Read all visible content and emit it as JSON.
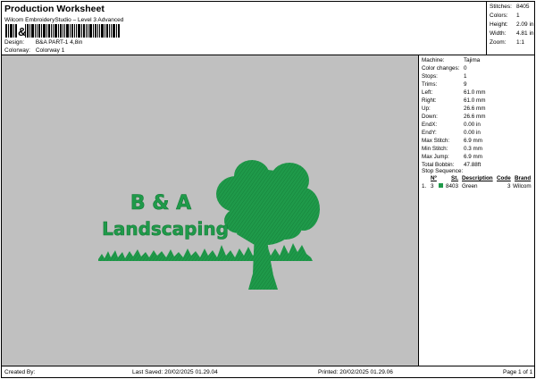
{
  "header": {
    "title": "Production Worksheet",
    "subtitle": "Wilcom EmbroideryStudio – Level 3 Advanced",
    "design_label": "Design:",
    "design_value": "B&A PART-1 4,8in",
    "colorway_label": "Colorway:",
    "colorway_value": "Colorway 1"
  },
  "stats": [
    {
      "label": "Stitches:",
      "value": "8405"
    },
    {
      "label": "Colors:",
      "value": "1"
    },
    {
      "label": "Height:",
      "value": "2.09 in"
    },
    {
      "label": "Width:",
      "value": "4.81 in"
    },
    {
      "label": "Zoom:",
      "value": "1:1"
    }
  ],
  "machine_info": [
    {
      "label": "Machine:",
      "value": "Tajima"
    },
    {
      "label": "Color changes:",
      "value": "0"
    },
    {
      "label": "Stops:",
      "value": "1"
    },
    {
      "label": "Trims:",
      "value": "9"
    },
    {
      "label": "Left:",
      "value": "61.0 mm"
    },
    {
      "label": "Right:",
      "value": "61.0 mm"
    },
    {
      "label": "Up:",
      "value": "26.6 mm"
    },
    {
      "label": "Down:",
      "value": "26.6 mm"
    },
    {
      "label": "EndX:",
      "value": "0.00 in"
    },
    {
      "label": "EndY:",
      "value": "0.00 in"
    },
    {
      "label": "Max Stitch:",
      "value": "6.9 mm"
    },
    {
      "label": "Min Stitch:",
      "value": "0.3 mm"
    },
    {
      "label": "Max Jump:",
      "value": "6.9 mm"
    },
    {
      "label": "Total Bobbin:",
      "value": "47.88ft"
    }
  ],
  "stop_sequence": {
    "title": "Stop Sequence:",
    "columns": [
      "Nº",
      "St.",
      "Description",
      "Code",
      "Brand"
    ],
    "rows": [
      {
        "index": "1.",
        "needle": "3",
        "stitches": "8403",
        "description": "Green",
        "code": "3",
        "brand": "Wilcom",
        "color": "#1f9a4a"
      }
    ]
  },
  "design": {
    "line1": "B & A",
    "line2": "Landscaping",
    "thread_color": "#1f9a4a",
    "thread_dark": "#137a35",
    "canvas_color": "#c0c0c0"
  },
  "footer": {
    "created_by": "Created By:",
    "last_saved": "Last Saved: 20/02/2025 01.29.04",
    "printed": "Printed: 20/02/2025 01.29.06",
    "page": "Page 1 of 1"
  }
}
